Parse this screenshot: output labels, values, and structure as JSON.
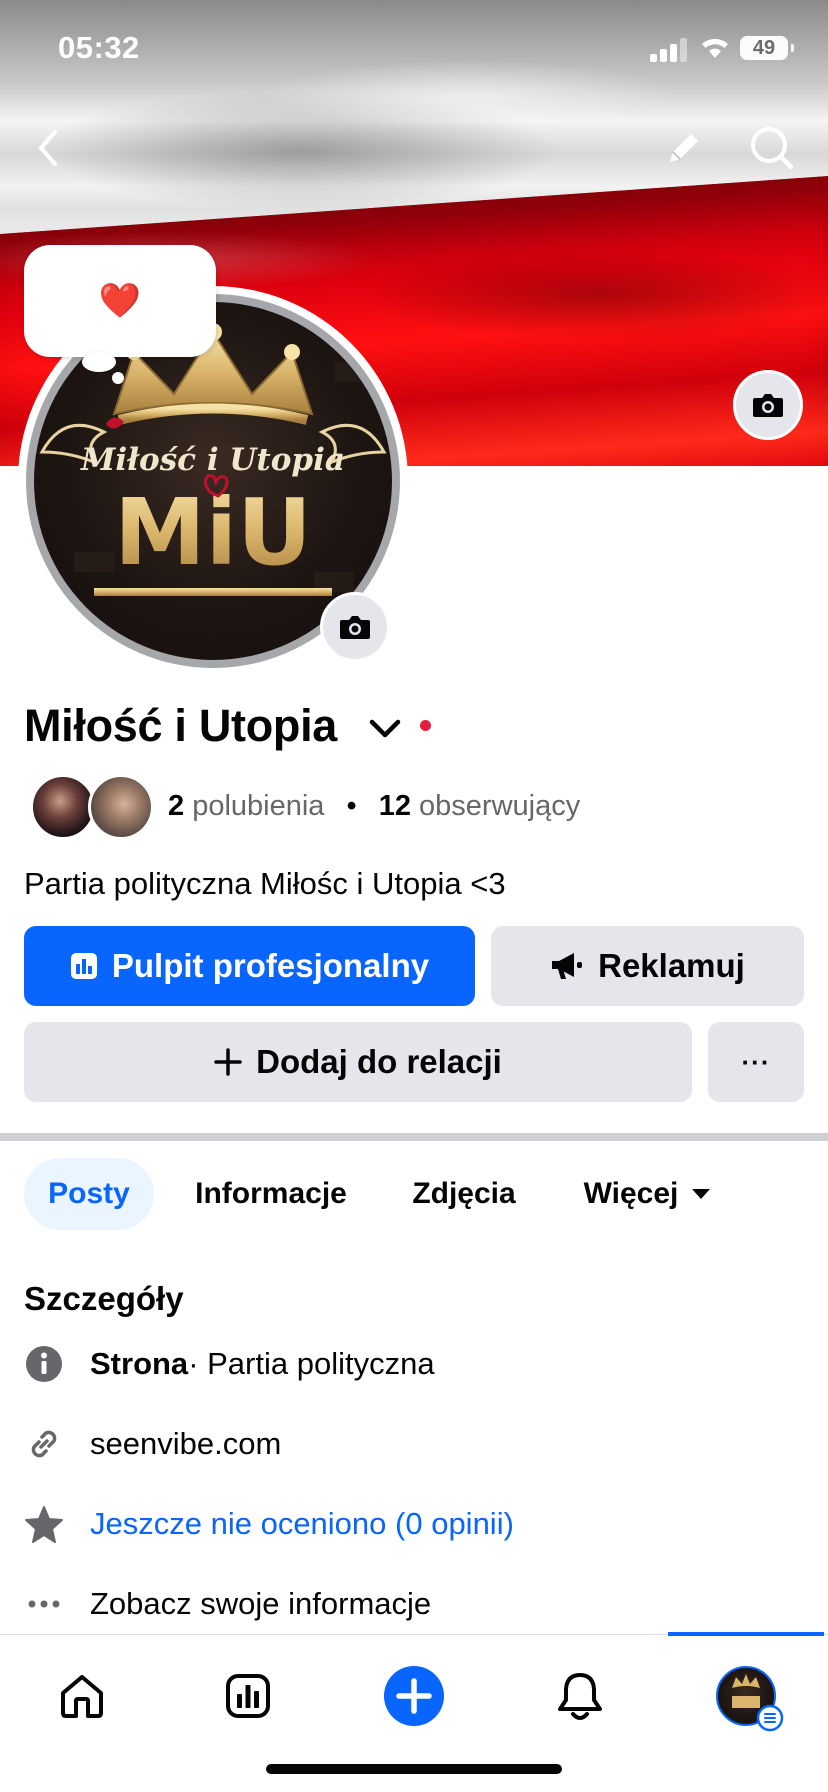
{
  "status_bar": {
    "time": "05:32",
    "battery": "49"
  },
  "profile": {
    "name": "Miłość i Utopia",
    "note_emoji": "❤️",
    "logo_text_top": "Miłość i Utopia",
    "logo_text_big": "MiU",
    "likes_count": "2",
    "likes_label": "polubienia",
    "separator": "•",
    "followers_count": "12",
    "followers_label": "obserwujący",
    "bio": "Partia polityczna Miłośc i Utopia <3"
  },
  "actions": {
    "professional_dashboard": "Pulpit profesjonalny",
    "advertise": "Reklamuj",
    "add_to_story": "Dodaj do relacji",
    "more": "···"
  },
  "tabs": [
    {
      "label": "Posty"
    },
    {
      "label": "Informacje"
    },
    {
      "label": "Zdjęcia"
    },
    {
      "label": "Więcej"
    }
  ],
  "details": {
    "title": "Szczegóły",
    "page_type_bold": "Strona",
    "page_type_rest": " · Partia polityczna",
    "website": "seenvibe.com",
    "rating": "Jeszcze nie oceniono (0 opinii)",
    "see_info": "Zobacz swoje informacje"
  },
  "colors": {
    "brand_blue": "#0866ff",
    "secondary_button": "#e4e6eb",
    "active_tab_bg": "#ebf5ff",
    "live_dot": "#e41e3f"
  },
  "icons": {
    "back": "chevron-left-icon",
    "edit": "pencil-icon",
    "search": "search-icon",
    "camera": "camera-icon",
    "dashboard": "bar-chart-icon",
    "advertise": "megaphone-icon",
    "add": "plus-icon",
    "info": "info-icon",
    "link": "link-icon",
    "star": "star-icon",
    "more": "ellipsis-icon",
    "home": "home-icon",
    "insights": "insights-icon",
    "create": "plus-circle-icon",
    "notifications": "bell-icon"
  }
}
